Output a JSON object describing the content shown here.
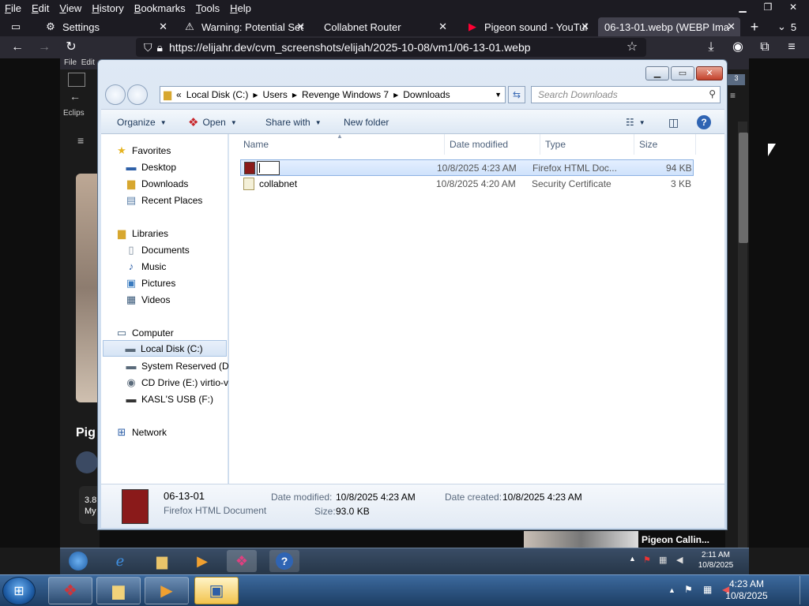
{
  "browser": {
    "menu": [
      {
        "label": "File",
        "hot": "F"
      },
      {
        "label": "Edit",
        "hot": "E"
      },
      {
        "label": "View",
        "hot": "V"
      },
      {
        "label": "History",
        "hot": "H"
      },
      {
        "label": "Bookmarks",
        "hot": "B"
      },
      {
        "label": "Tools",
        "hot": "T"
      },
      {
        "label": "Help",
        "hot": "H"
      }
    ],
    "tabs": [
      {
        "label": "Settings",
        "icon": "gear-icon"
      },
      {
        "label": "Warning: Potential Sec",
        "icon": "warning-icon"
      },
      {
        "label": "Collabnet Router",
        "icon": ""
      },
      {
        "label": "Pigeon sound - YouTul",
        "icon": "youtube-icon"
      },
      {
        "label": "06-13-01.webp (WEBP Ima",
        "icon": ""
      }
    ],
    "tab_count": "5",
    "url": "https://elijahr.dev/cvm_screenshots/elijah/2025-10-08/vm1/06-13-01.webp"
  },
  "inner_page": {
    "menu_file": "File",
    "menu_edit": "Edit",
    "bookmark": "Eclips",
    "title_fragment": "Pig",
    "stat_fragment": "3.8",
    "stat_fragment2": "My",
    "video_label": "Pigeon Callin...",
    "badge": "3"
  },
  "explorer": {
    "breadcrumb": [
      "Local Disk (C:)",
      "Users",
      "Revenge Windows 7",
      "Downloads"
    ],
    "breadcrumb_prefix": "«",
    "search_placeholder": "Search Downloads",
    "toolbar": {
      "organize": "Organize",
      "open": "Open",
      "share_with": "Share with",
      "new_folder": "New folder"
    },
    "nav": [
      {
        "label": "Favorites",
        "icon": "star-icon",
        "level": 0
      },
      {
        "label": "Desktop",
        "icon": "desktop-icon",
        "level": 1
      },
      {
        "label": "Downloads",
        "icon": "folder-icon",
        "level": 1
      },
      {
        "label": "Recent Places",
        "icon": "recent-icon",
        "level": 1
      },
      {
        "label": "Libraries",
        "icon": "library-icon",
        "level": 0
      },
      {
        "label": "Documents",
        "icon": "document-icon",
        "level": 1
      },
      {
        "label": "Music",
        "icon": "music-icon",
        "level": 1
      },
      {
        "label": "Pictures",
        "icon": "picture-icon",
        "level": 1
      },
      {
        "label": "Videos",
        "icon": "video-icon",
        "level": 1
      },
      {
        "label": "Computer",
        "icon": "computer-icon",
        "level": 0
      },
      {
        "label": "Local Disk (C:)",
        "icon": "drive-icon",
        "level": 1,
        "selected": true
      },
      {
        "label": "System Reserved (D:",
        "icon": "drive-icon",
        "level": 1
      },
      {
        "label": "CD Drive (E:) virtio-v",
        "icon": "cd-icon",
        "level": 1
      },
      {
        "label": "KASL'S USB (F:)",
        "icon": "usb-icon",
        "level": 1
      },
      {
        "label": "Network",
        "icon": "network-icon",
        "level": 0
      }
    ],
    "columns": [
      "Name",
      "Date modified",
      "Type",
      "Size"
    ],
    "files": [
      {
        "name": "",
        "date": "10/8/2025 4:23 AM",
        "type": "Firefox HTML Doc...",
        "size": "94 KB",
        "selected": true,
        "renaming": true
      },
      {
        "name": "collabnet",
        "date": "10/8/2025 4:20 AM",
        "type": "Security Certificate",
        "size": "3 KB",
        "selected": false
      }
    ],
    "details": {
      "filename": "06-13-01",
      "filetype": "Firefox HTML Document",
      "date_modified_label": "Date modified:",
      "date_modified": "10/8/2025 4:23 AM",
      "date_created_label": "Date created:",
      "date_created": "10/8/2025 4:23 AM",
      "size_label": "Size:",
      "size": "93.0 KB"
    }
  },
  "inner_taskbar": {
    "time": "2:11 AM",
    "date": "10/8/2025"
  },
  "taskbar": {
    "time": "4:23 AM",
    "date": "10/8/2025"
  }
}
